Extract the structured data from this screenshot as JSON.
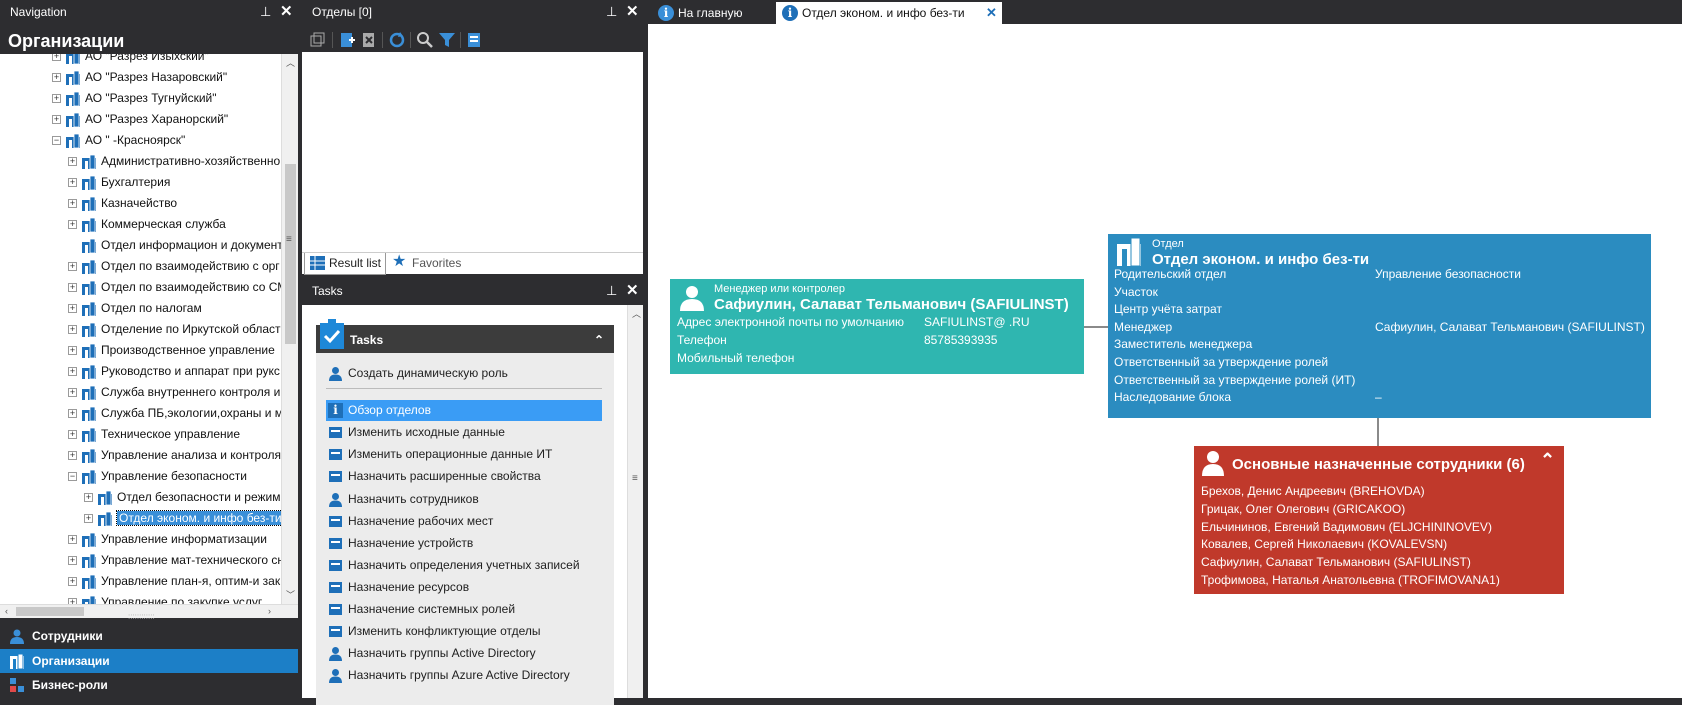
{
  "nav": {
    "title": "Navigation",
    "heading": "Организации",
    "tree": [
      {
        "label": "АО \"Разрез Изыхский\"",
        "level": 1,
        "expander": "+"
      },
      {
        "label": "АО \"Разрез Назаровский\"",
        "level": 1,
        "expander": "+"
      },
      {
        "label": "АО \"Разрез Тугнуйский\"",
        "level": 1,
        "expander": "+"
      },
      {
        "label": "АО \"Разрез Харанорский\"",
        "level": 1,
        "expander": "+"
      },
      {
        "label": "АО \"         -Красноярск\"",
        "level": 1,
        "expander": "−"
      },
      {
        "label": "Административно-хозяйственно",
        "level": 2,
        "expander": "+"
      },
      {
        "label": "Бухгалтерия",
        "level": 2,
        "expander": "+"
      },
      {
        "label": "Казначейство",
        "level": 2,
        "expander": "+"
      },
      {
        "label": "Коммерческая служба",
        "level": 2,
        "expander": "+"
      },
      {
        "label": "Отдел информацион и документ",
        "level": 2,
        "expander": ""
      },
      {
        "label": "Отдел по взаимодействию с орг",
        "level": 2,
        "expander": "+"
      },
      {
        "label": "Отдел по взаимодействию со СМ",
        "level": 2,
        "expander": "+"
      },
      {
        "label": "Отдел по налогам",
        "level": 2,
        "expander": "+"
      },
      {
        "label": "Отделение по Иркутской област",
        "level": 2,
        "expander": "+"
      },
      {
        "label": "Производственное управление",
        "level": 2,
        "expander": "+"
      },
      {
        "label": "Руководство и аппарат при рукс",
        "level": 2,
        "expander": "+"
      },
      {
        "label": "Служба внутреннего контроля и",
        "level": 2,
        "expander": "+"
      },
      {
        "label": "Служба ПБ,экологии,охраны и м",
        "level": 2,
        "expander": "+"
      },
      {
        "label": "Техническое управление",
        "level": 2,
        "expander": "+"
      },
      {
        "label": "Управление анализа и контроля",
        "level": 2,
        "expander": "+"
      },
      {
        "label": "Управление безопасности",
        "level": 2,
        "expander": "−"
      },
      {
        "label": "Отдел безопасности и режим",
        "level": 3,
        "expander": "+"
      },
      {
        "label": "Отдел эконом. и инфо без-ти",
        "level": 3,
        "expander": "+",
        "selected": true
      },
      {
        "label": "Управление информатизации",
        "level": 2,
        "expander": "+"
      },
      {
        "label": "Управление мат-технического сн",
        "level": 2,
        "expander": "+"
      },
      {
        "label": "Управление план-я, оптим-и зак",
        "level": 2,
        "expander": "+"
      },
      {
        "label": "Управление по закупке услуг",
        "level": 2,
        "expander": "+"
      }
    ],
    "bottom": [
      "Сотрудники",
      "Организации",
      "Бизнес-роли"
    ],
    "grip": "::::::::::::"
  },
  "results": {
    "title": "Отделы [0]",
    "tab_result": "Result list",
    "tab_favorites": "Favorites"
  },
  "tasks": {
    "title": "Tasks",
    "box_title": "Tasks",
    "items": [
      "Создать динамическую роль",
      "Обзор отделов",
      "Изменить исходные данные",
      "Изменить операционные данные ИТ",
      "Назначить расширенные свойства",
      "Назначить сотрудников",
      "Назначение рабочих мест",
      "Назначение устройств",
      "Назначить определения учетных записей",
      "Назначение ресурсов",
      "Назначение системных ролей",
      "Изменить конфликтующие отделы",
      "Назначить группы Active Directory",
      "Назначить группы Azure Active Directory"
    ]
  },
  "doc_tabs": {
    "home": "На главную",
    "active": "Отдел эконом. и инфо без-ти"
  },
  "manager_card": {
    "caption": "Менеджер или контролер",
    "name": "Сафиулин, Салават Тельманович (SAFIULINST)",
    "fields": [
      {
        "label": "Адрес электронной почты по умолчанию",
        "value": "SAFIULINST@           .RU"
      },
      {
        "label": "Телефон",
        "value": "85785393935"
      },
      {
        "label": "Мобильный телефон",
        "value": ""
      }
    ],
    "color": "#2fb6b0"
  },
  "dept_card": {
    "caption": "Отдел",
    "name": "Отдел эконом. и инфо без-ти",
    "fields": [
      {
        "label": "Родительский отдел",
        "value": "Управление безопасности"
      },
      {
        "label": "Участок",
        "value": ""
      },
      {
        "label": "Центр учёта затрат",
        "value": ""
      },
      {
        "label": "Менеджер",
        "value": "Сафиулин, Салават Тельманович (SAFIULINST)"
      },
      {
        "label": "Заместитель менеджера",
        "value": ""
      },
      {
        "label": "Ответственный за утверждение ролей",
        "value": ""
      },
      {
        "label": "Ответственный за утверждение ролей (ИТ)",
        "value": ""
      },
      {
        "label": "Наследование блока",
        "value": "–"
      }
    ],
    "color": "#2b8cc0"
  },
  "employees_card": {
    "title": "Основные назначенные сотрудники (6)",
    "people": [
      "Брехов, Денис Андреевич (BREHOVDA)",
      "Грицак, Олег Олегович (GRICAKOO)",
      "Ельчининов, Евгений Вадимович (ELJCHININOVEV)",
      "Ковалев, Сергей Николаевич (KOVALEVSN)",
      "Сафиулин, Салават Тельманович (SAFIULINST)",
      "Трофимова, Наталья Анатольевна (TROFIMOVANA1)"
    ],
    "color": "#c0392b"
  }
}
